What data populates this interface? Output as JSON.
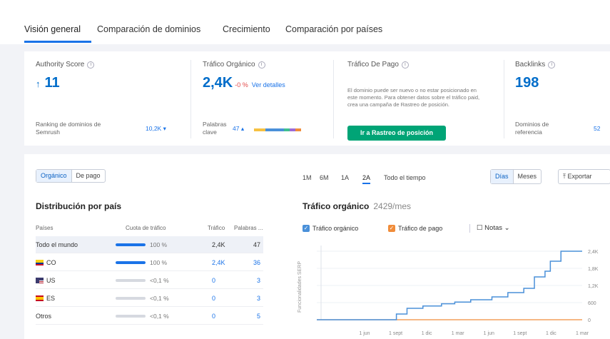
{
  "tabs": [
    "Visión general",
    "Comparación de dominios",
    "Crecimiento",
    "Comparación por países"
  ],
  "metrics": {
    "authority": {
      "label": "Authority Score",
      "value": "11",
      "arrow": "↑",
      "sub_label": "Ranking de dominios de Semrush",
      "sub_value": "10,2K ▾"
    },
    "organic": {
      "label": "Tráfico Orgánico",
      "value": "2,4K",
      "change": "-0 %",
      "link": "Ver detalles",
      "sub_label": "Palabras clave",
      "sub_value": "47 ▴"
    },
    "paid": {
      "label": "Tráfico De Pago",
      "description": "El dominio puede ser nuevo o no estar posicionado en este momento. Para obtener datos sobre el tráfico paid, crea una campaña de Rastreo de posición.",
      "cta": "Ir a Rastreo de posición"
    },
    "backlinks": {
      "label": "Backlinks",
      "value": "198",
      "sub_label": "Dominios de referencia",
      "sub_value": "52"
    }
  },
  "left_panel": {
    "toggle": [
      "Orgánico",
      "De pago"
    ],
    "title": "Distribución por país",
    "columns": [
      "Países",
      "Cuota de tráfico",
      "Tráfico",
      "Palabras ..."
    ],
    "rows": [
      {
        "country": "Todo el mundo",
        "flag": "",
        "share": "100 %",
        "bar": 1.0,
        "traffic": "2,4K",
        "keywords": "47"
      },
      {
        "country": "CO",
        "flag": "co",
        "share": "100 %",
        "bar": 1.0,
        "traffic": "2,4K",
        "keywords": "36"
      },
      {
        "country": "US",
        "flag": "us",
        "share": "<0,1 %",
        "bar": 0.0,
        "traffic": "0",
        "keywords": "3"
      },
      {
        "country": "ES",
        "flag": "es",
        "share": "<0,1 %",
        "bar": 0.0,
        "traffic": "0",
        "keywords": "3"
      },
      {
        "country": "Otros",
        "flag": "",
        "share": "<0,1 %",
        "bar": 0.0,
        "traffic": "0",
        "keywords": "5"
      }
    ]
  },
  "right_panel": {
    "periods": [
      "1M",
      "6M",
      "1A",
      "2A",
      "Todo el tiempo"
    ],
    "selected_period": "2A",
    "granularity": [
      "Días",
      "Meses"
    ],
    "export_label": "Exportar",
    "title": "Tráfico orgánico",
    "subtitle": "2429/mes",
    "legend": [
      "Tráfico orgánico",
      "Tráfico de pago"
    ],
    "notes_label": "Notas",
    "y_axis_label": "Funcionalidades SERP"
  },
  "colors": {
    "accent": "#1a73e8",
    "organic": "#4a90d9",
    "paid": "#f08c3a",
    "cta": "#00a476"
  },
  "chart_data": {
    "type": "line",
    "x_ticks": [
      "1 jun",
      "1 sept",
      "1 dic",
      "1 mar",
      "1 jun",
      "1 sept",
      "1 dic",
      "1 mar"
    ],
    "y_ticks": [
      "0",
      "600",
      "1,2K",
      "1,8K",
      "2,4K"
    ],
    "ylim": [
      0,
      2600
    ],
    "series": [
      {
        "name": "Tráfico orgánico",
        "x": [
          0,
          0.28,
          0.3,
          0.34,
          0.4,
          0.47,
          0.52,
          0.58,
          0.66,
          0.72,
          0.78,
          0.82,
          0.86,
          0.88,
          0.92,
          1.0
        ],
        "values": [
          0,
          0,
          200,
          400,
          480,
          560,
          620,
          700,
          800,
          950,
          1100,
          1500,
          1700,
          2050,
          2400,
          2400
        ]
      },
      {
        "name": "Tráfico de pago",
        "x": [
          0,
          1.0
        ],
        "values": [
          0,
          0
        ]
      }
    ]
  }
}
